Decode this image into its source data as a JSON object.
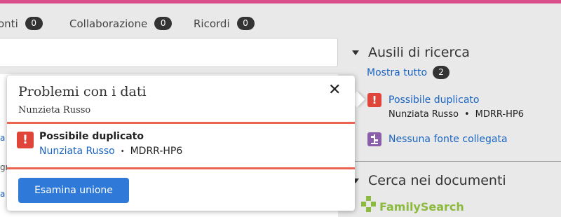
{
  "tabs": [
    {
      "label": "onti",
      "count": "0"
    },
    {
      "label": "Collaborazione",
      "count": "0"
    },
    {
      "label": "Ricordi",
      "count": "0"
    }
  ],
  "left_snippets": [
    "a",
    "gr",
    "a"
  ],
  "research_helps": {
    "title": "Ausili di ricerca",
    "show_all": "Mostra tutto",
    "show_all_count": "2",
    "items": [
      {
        "icon": "warning-icon",
        "label": "Possibile duplicato",
        "person": "Nunziata Russo",
        "bullet": "•",
        "id": "MDRR-HP6"
      },
      {
        "icon": "tree-icon",
        "label": "Nessuna fonte collegata"
      }
    ]
  },
  "search_documents": {
    "title": "Cerca nei documenti",
    "logo_text": "FamilySearch"
  },
  "popover": {
    "title": "Problemi con i dati",
    "subtitle": "Nunzieta Russo",
    "close_symbol": "✕",
    "item": {
      "icon_symbol": "!",
      "title": "Possibile duplicato",
      "person": "Nunziata Russo",
      "bullet": "•",
      "id": "MDRR-HP6"
    },
    "button_label": "Esamina unione"
  },
  "colors": {
    "accent": "#d94f8c",
    "link": "#1a64c1",
    "warning": "#e0453a",
    "primary_button": "#2f7ad9",
    "familysearch_green": "#8cba3e"
  }
}
